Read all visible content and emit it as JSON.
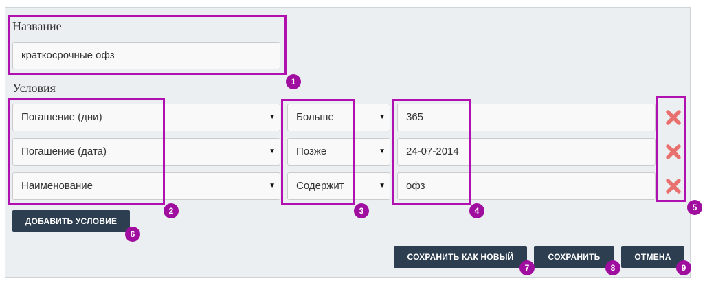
{
  "form": {
    "name_label": "Название",
    "name_value": "краткосрочные офз",
    "conditions_label": "Условия",
    "conditions": [
      {
        "field": "Погашение (дни)",
        "operator": "Больше",
        "value": "365"
      },
      {
        "field": "Погашение (дата)",
        "operator": "Позже",
        "value": "24-07-2014"
      },
      {
        "field": "Наименование",
        "operator": "Содержит",
        "value": "офз"
      }
    ],
    "add_condition_label": "ДОБАВИТЬ УСЛОВИЕ",
    "save_as_new_label": "СОХРАНИТЬ КАК НОВЫЙ",
    "save_label": "СОХРАНИТЬ",
    "cancel_label": "ОТМЕНА"
  },
  "annotations": [
    "1",
    "2",
    "3",
    "4",
    "5",
    "6",
    "7",
    "8",
    "9"
  ],
  "colors": {
    "accent": "#b010b0",
    "button": "#2c3e50",
    "delete": "#e8706e",
    "panel": "#eceff1"
  },
  "icons": {
    "delete": "close-icon",
    "dropdown": "caret-down-icon"
  }
}
